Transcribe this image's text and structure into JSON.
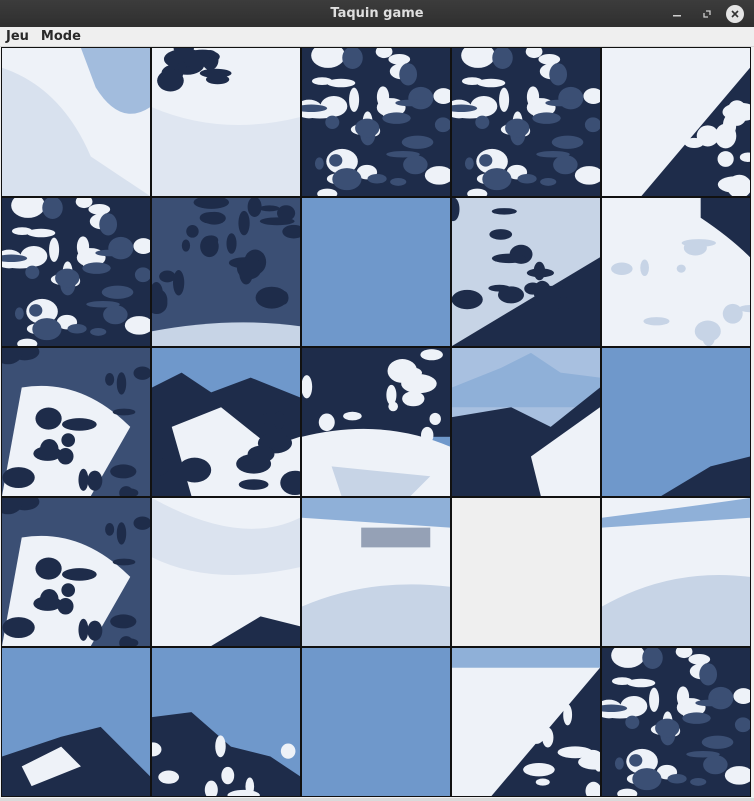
{
  "window": {
    "title": "Taquin game",
    "controls": [
      "minimize-icon",
      "restore-icon",
      "close-icon"
    ]
  },
  "menu": {
    "items": [
      "Jeu",
      "Mode"
    ]
  },
  "board": {
    "rows": 5,
    "cols": 5,
    "empty_tile": {
      "row": 3,
      "col": 3
    },
    "tiles": [
      {
        "kind": "snow"
      },
      {
        "kind": "snow-rocky-top"
      },
      {
        "kind": "rock-dark"
      },
      {
        "kind": "rock-dark"
      },
      {
        "kind": "rock-snow-diag"
      },
      {
        "kind": "rock-dark"
      },
      {
        "kind": "rock-dark-sky"
      },
      {
        "kind": "sky"
      },
      {
        "kind": "rock-snow-diag2"
      },
      {
        "kind": "snow-rock"
      },
      {
        "kind": "rock-snow"
      },
      {
        "kind": "peak-sky"
      },
      {
        "kind": "rock-glacier"
      },
      {
        "kind": "distant-peak"
      },
      {
        "kind": "sky-ridge"
      },
      {
        "kind": "rock-snow"
      },
      {
        "kind": "snow-slope"
      },
      {
        "kind": "snow-ridges"
      },
      {
        "kind": "empty"
      },
      {
        "kind": "snow-ridges2"
      },
      {
        "kind": "sky-summit-left"
      },
      {
        "kind": "sky-summit-right"
      },
      {
        "kind": "sky"
      },
      {
        "kind": "snow-rock-bottom"
      },
      {
        "kind": "rock-dark"
      }
    ]
  },
  "colors": {
    "sky": "#6f98cb",
    "sky_light": "#8fb0d8",
    "rock": "#1e2c4a",
    "rock_mid": "#3b4f74",
    "snow": "#eef2f8",
    "snow_shadow": "#c7d4e6",
    "empty": "#efefef"
  }
}
